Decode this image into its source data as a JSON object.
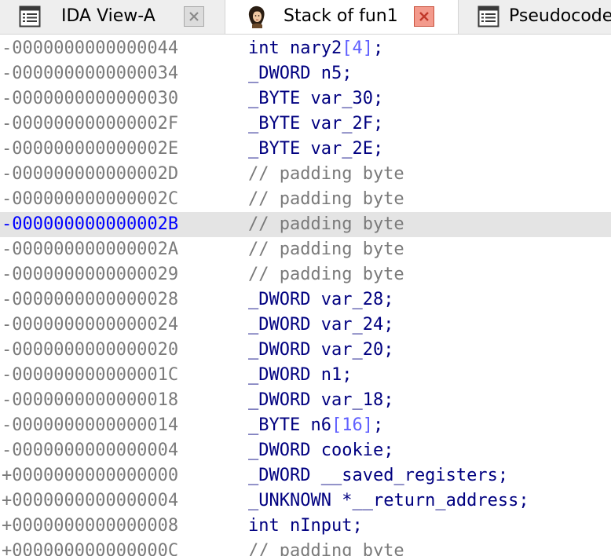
{
  "tabs": [
    {
      "label": "IDA View-A",
      "icon": "disassembly-view-icon",
      "active": false,
      "closable": true
    },
    {
      "label": "Stack of fun1",
      "icon": "ida-lady-icon",
      "active": true,
      "closable": true
    },
    {
      "label": "Pseudocode",
      "icon": "pseudocode-view-icon",
      "active": false,
      "closable": false
    }
  ],
  "colors": {
    "keyword": "#000080",
    "number": "#6060ff",
    "comment": "#7a7a7a",
    "offset": "#7a7a7a",
    "highlight_offset": "#0000ff",
    "highlight_bg": "#e4e4e4",
    "close_active_bg": "#f39a8c"
  },
  "rows": [
    {
      "offset": "-0000000000000044",
      "type": "int",
      "name": "nary2",
      "array_size": "4",
      "highlighted": false
    },
    {
      "offset": "-0000000000000034",
      "type": "_DWORD",
      "name": "n5",
      "highlighted": false
    },
    {
      "offset": "-0000000000000030",
      "type": "_BYTE",
      "name": "var_30",
      "highlighted": false
    },
    {
      "offset": "-000000000000002F",
      "type": "_BYTE",
      "name": "var_2F",
      "highlighted": false
    },
    {
      "offset": "-000000000000002E",
      "type": "_BYTE",
      "name": "var_2E",
      "highlighted": false
    },
    {
      "offset": "-000000000000002D",
      "comment": "// padding byte",
      "highlighted": false
    },
    {
      "offset": "-000000000000002C",
      "comment": "// padding byte",
      "highlighted": false
    },
    {
      "offset": "-000000000000002B",
      "comment": "// padding byte",
      "highlighted": true
    },
    {
      "offset": "-000000000000002A",
      "comment": "// padding byte",
      "highlighted": false
    },
    {
      "offset": "-0000000000000029",
      "comment": "// padding byte",
      "highlighted": false
    },
    {
      "offset": "-0000000000000028",
      "type": "_DWORD",
      "name": "var_28",
      "highlighted": false
    },
    {
      "offset": "-0000000000000024",
      "type": "_DWORD",
      "name": "var_24",
      "highlighted": false
    },
    {
      "offset": "-0000000000000020",
      "type": "_DWORD",
      "name": "var_20",
      "highlighted": false
    },
    {
      "offset": "-000000000000001C",
      "type": "_DWORD",
      "name": "n1",
      "highlighted": false
    },
    {
      "offset": "-0000000000000018",
      "type": "_DWORD",
      "name": "var_18",
      "highlighted": false
    },
    {
      "offset": "-0000000000000014",
      "type": "_BYTE",
      "name": "n6",
      "array_size": "16",
      "highlighted": false
    },
    {
      "offset": "-0000000000000004",
      "type": "_DWORD",
      "name": "cookie",
      "highlighted": false
    },
    {
      "offset": "+0000000000000000",
      "type": "_DWORD",
      "name": "__saved_registers",
      "highlighted": false
    },
    {
      "offset": "+0000000000000004",
      "type": "_UNKNOWN",
      "name": "*__return_address",
      "highlighted": false
    },
    {
      "offset": "+0000000000000008",
      "type": "int",
      "name": "nInput",
      "highlighted": false
    },
    {
      "offset": "+000000000000000C",
      "comment": "// padding byte",
      "highlighted": false
    }
  ]
}
